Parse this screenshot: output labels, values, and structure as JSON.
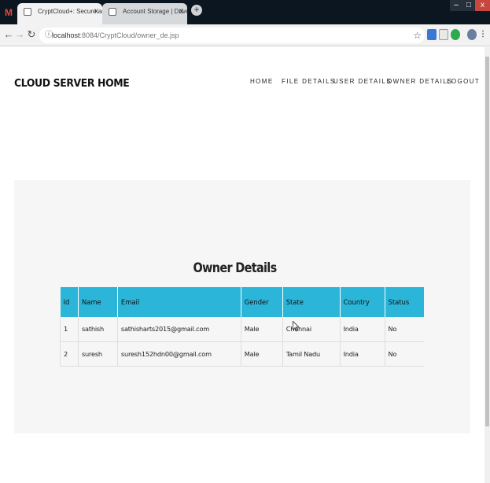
{
  "browser": {
    "tabs": [
      {
        "label": "CryptCloud+: Secure and Expres",
        "active": true
      },
      {
        "label": "Account Storage | DriveHQ",
        "active": false
      }
    ],
    "first_tab_letter": "M",
    "new_tab": "+",
    "close_glyph": "x",
    "url_host": "localhost",
    "url_path": ":8084/CryptCloud/owner_de.jsp",
    "window_controls": {
      "min": "–",
      "max": "□",
      "close": "x"
    }
  },
  "header": {
    "brand": "CLOUD SERVER HOME",
    "nav": {
      "home": "HOME",
      "files": "FILE DETAILS",
      "users": "USER DETAILS",
      "owners": "OWNER DETAILS",
      "logout": "LOGOUT"
    }
  },
  "section": {
    "title": "Owner Details"
  },
  "table": {
    "headers": [
      "Id",
      "Name",
      "Email",
      "Gender",
      "State",
      "Country",
      "Status"
    ],
    "rows": [
      [
        "1",
        "sathish",
        "sathisharts2015@gmail.com",
        "Male",
        "Chennai",
        "India",
        "No"
      ],
      [
        "2",
        "suresh",
        "suresh152hdn00@gmail.com",
        "Male",
        "Tamil Nadu",
        "India",
        "No"
      ]
    ]
  },
  "colors": {
    "table_header": "#2bb5d8",
    "panel_bg": "#f6f6f6",
    "titlebar": "#0b1620"
  },
  "icons": [
    "gmail-icon",
    "page-icon",
    "back-icon",
    "forward-icon",
    "reload-icon",
    "info-icon",
    "star-icon",
    "extension-icon",
    "profile-icon",
    "menu-icon",
    "cursor-icon"
  ]
}
